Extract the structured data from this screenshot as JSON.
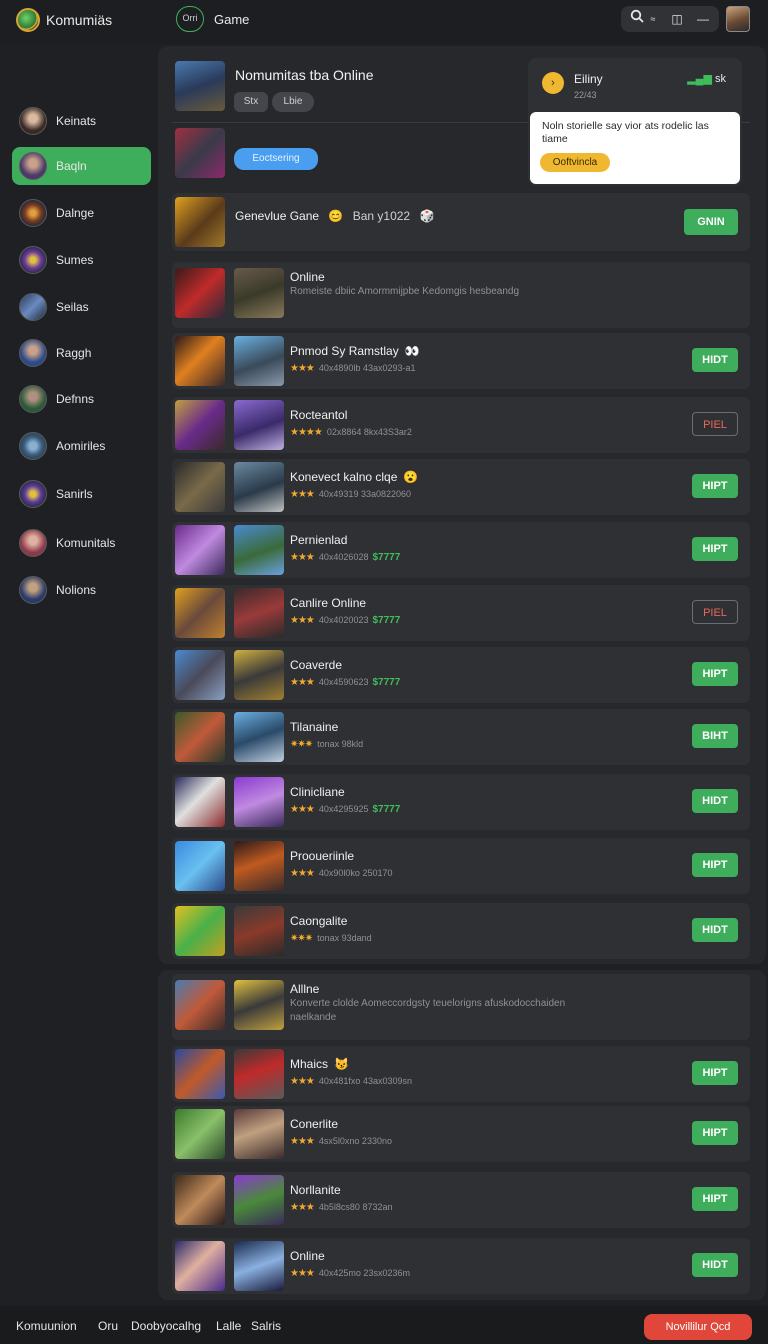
{
  "app": {
    "title": "Komumiäs",
    "game_pill": "Orri",
    "game_label": "Game"
  },
  "header_tools": {
    "search": "Q",
    "search_sub": "≈",
    "view": "◫",
    "min": "—"
  },
  "sidebar": {
    "items": [
      {
        "label": "Keinats",
        "active": false
      },
      {
        "label": "Baqln",
        "active": true
      },
      {
        "label": "Dalnge",
        "active": false
      },
      {
        "label": "Sumes",
        "active": false
      },
      {
        "label": "Seilas",
        "active": false
      },
      {
        "label": "Raggh",
        "active": false
      },
      {
        "label": "Defnns",
        "active": false
      },
      {
        "label": "Aomiriles",
        "active": false
      },
      {
        "label": "Sanirls",
        "active": false
      },
      {
        "label": "Komunitals",
        "active": false
      },
      {
        "label": "Nolions",
        "active": false
      }
    ]
  },
  "hero": {
    "title": "Nomumitas tba Online",
    "tag1": "Stx",
    "tag2": "Lbie",
    "featured_pill": "Eoctsering"
  },
  "popup": {
    "coin": "›",
    "title": "Eiliny",
    "subtitle": "22/43",
    "signal_icon": "▂▄▆",
    "signal_label": "sk",
    "message": "Noln storielle say vior ats rodelic las tiame",
    "button": "Ooftvincla"
  },
  "generic": {
    "title": "Genevlue Gane",
    "emoji": "😊",
    "date": "Ban y1022",
    "emoji2": "🎲",
    "button": "GNIN"
  },
  "online_block": {
    "title": "Online",
    "desc": "Romeiste dbiic Amormmijpbe Kedomgis hesbeandg"
  },
  "rows": [
    {
      "title": "Pnmod Sy Ramstlay",
      "emoji": "👀",
      "stars": "★★★",
      "meta": "40x4890lb 43ax0293-a1",
      "price": "",
      "button": "HIDT",
      "style": "green"
    },
    {
      "title": "Rocteantol",
      "emoji": "",
      "stars": "★★★★",
      "meta": "02x8864 8kx43S3ar2",
      "price": "",
      "button": "PIEL",
      "style": "outline"
    },
    {
      "title": "Konevect kalno clqe",
      "emoji": "😮",
      "stars": "★★★",
      "meta": "40x49319 33a0822060",
      "price": "",
      "button": "HIPT",
      "style": "green"
    },
    {
      "title": "Pernienlad",
      "emoji": "",
      "stars": "★★★",
      "meta": "40x4026028",
      "price": "$7777",
      "button": "HIPT",
      "style": "green"
    },
    {
      "title": "Canlire Online",
      "emoji": "",
      "stars": "★★★",
      "meta": "40x4020023",
      "price": "$7777",
      "button": "PIEL",
      "style": "outline"
    },
    {
      "title": "Coaverde",
      "emoji": "",
      "stars": "★★★",
      "meta": "40x4590623",
      "price": "$7777",
      "button": "HIPT",
      "style": "green"
    },
    {
      "title": "Tilanaine",
      "emoji": "",
      "stars": "✷✷✷",
      "meta": "tonax 98kld",
      "price": "",
      "button": "BIHT",
      "style": "green"
    },
    {
      "title": "Clinicliane",
      "emoji": "",
      "stars": "★★★",
      "meta": "40x4295925",
      "price": "$7777",
      "button": "HIDT",
      "style": "green"
    },
    {
      "title": "Prooueriinle",
      "emoji": "",
      "stars": "★★★",
      "meta": "40x90l0ko 250170",
      "price": "",
      "button": "HIPT",
      "style": "green"
    },
    {
      "title": "Caongalite",
      "emoji": "",
      "stars": "✷✷✷",
      "meta": "tonax 93dand",
      "price": "",
      "button": "HIDT",
      "style": "green"
    }
  ],
  "allline_block": {
    "title": "Alllne",
    "desc": "Konverte clolde Aomeccordgsty teuelorigns afuskodocchaiden naelkande"
  },
  "rows2": [
    {
      "title": "Mhaics",
      "emoji": "😼",
      "stars": "★★★",
      "meta": "40x481fxo 43ax0309sn",
      "price": "",
      "button": "HIPT",
      "style": "green"
    },
    {
      "title": "Conerlite",
      "emoji": "",
      "stars": "★★★",
      "meta": "4sx5l0xno 2330no",
      "price": "",
      "button": "HIPT",
      "style": "green"
    },
    {
      "title": "Norllanite",
      "emoji": "",
      "stars": "★★★",
      "meta": "4b5l8cs80 8732an",
      "price": "",
      "button": "HIPT",
      "style": "green"
    },
    {
      "title": "Online",
      "emoji": "",
      "stars": "★★★",
      "meta": "40x425mo 23sx0236m",
      "price": "",
      "button": "HIDT",
      "style": "green"
    }
  ],
  "bottombar": {
    "links": [
      "Komuunion",
      "Oru",
      "Doobyocalhg",
      "Lalle",
      "Salris"
    ],
    "cta": "Novillilur Qcd"
  }
}
